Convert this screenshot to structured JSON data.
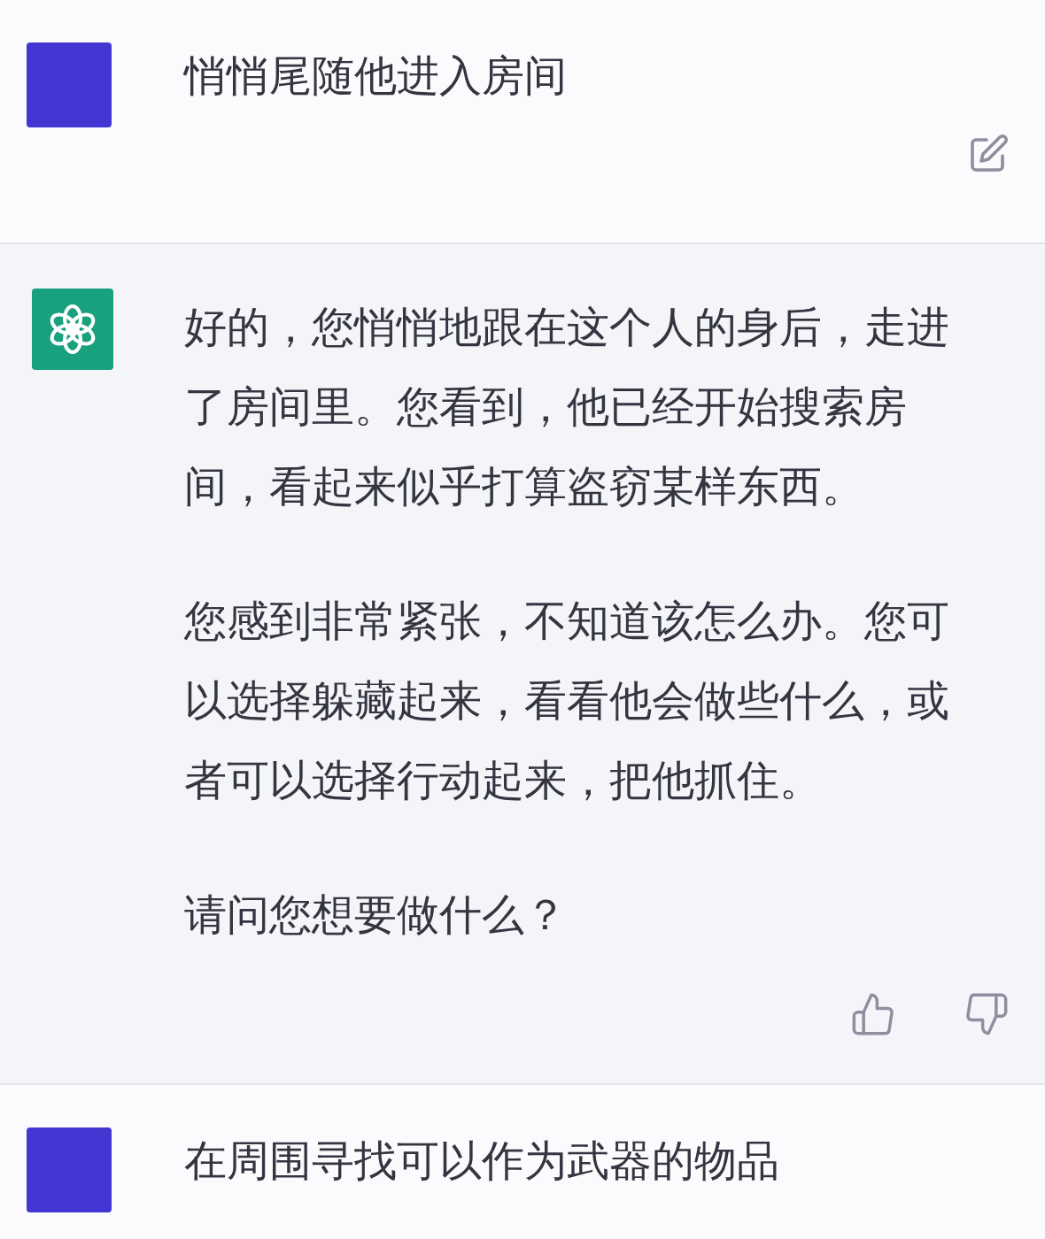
{
  "messages": [
    {
      "kind": "user",
      "paragraphs": [
        "悄悄尾随他进入房间"
      ],
      "edit_button": true
    },
    {
      "kind": "assistant",
      "paragraphs": [
        "好的，您悄悄地跟在这个人的身后，走进了房间里。您看到，他已经开始搜索房间，看起来似乎打算盗窃某样东西。",
        "您感到非常紧张，不知道该怎么办。您可以选择躲藏起来，看看他会做些什么，或者可以选择行动起来，把他抓住。",
        "请问您想要做什么？"
      ]
    },
    {
      "kind": "user",
      "paragraphs": [
        "在周围寻找可以作为武器的物品"
      ],
      "edit_button": false
    }
  ]
}
